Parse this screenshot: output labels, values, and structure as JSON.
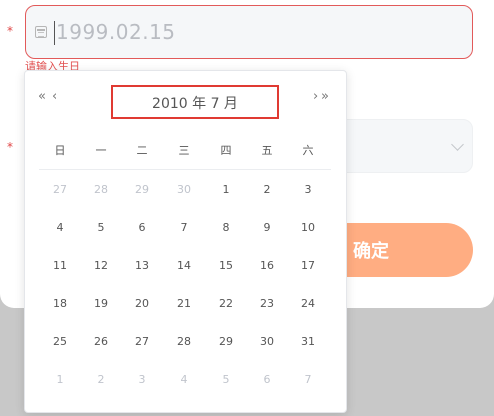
{
  "form": {
    "required_mark": "*",
    "date_value": "1999.02.15",
    "error_text": "请输入生日",
    "confirm_label": "确定"
  },
  "picker": {
    "nav_prev_year": "«",
    "nav_prev_month": "‹",
    "nav_next_month": "›",
    "nav_next_year": "»",
    "header": "2010 年  7 月",
    "weekdays": [
      "日",
      "一",
      "二",
      "三",
      "四",
      "五",
      "六"
    ],
    "weeks": [
      [
        {
          "d": "27",
          "o": true
        },
        {
          "d": "28",
          "o": true
        },
        {
          "d": "29",
          "o": true
        },
        {
          "d": "30",
          "o": true
        },
        {
          "d": "1",
          "o": false
        },
        {
          "d": "2",
          "o": false
        },
        {
          "d": "3",
          "o": false
        }
      ],
      [
        {
          "d": "4",
          "o": false
        },
        {
          "d": "5",
          "o": false
        },
        {
          "d": "6",
          "o": false
        },
        {
          "d": "7",
          "o": false
        },
        {
          "d": "8",
          "o": false
        },
        {
          "d": "9",
          "o": false
        },
        {
          "d": "10",
          "o": false
        }
      ],
      [
        {
          "d": "11",
          "o": false
        },
        {
          "d": "12",
          "o": false
        },
        {
          "d": "13",
          "o": false
        },
        {
          "d": "14",
          "o": false
        },
        {
          "d": "15",
          "o": false
        },
        {
          "d": "16",
          "o": false
        },
        {
          "d": "17",
          "o": false
        }
      ],
      [
        {
          "d": "18",
          "o": false
        },
        {
          "d": "19",
          "o": false
        },
        {
          "d": "20",
          "o": false
        },
        {
          "d": "21",
          "o": false
        },
        {
          "d": "22",
          "o": false
        },
        {
          "d": "23",
          "o": false
        },
        {
          "d": "24",
          "o": false
        }
      ],
      [
        {
          "d": "25",
          "o": false
        },
        {
          "d": "26",
          "o": false
        },
        {
          "d": "27",
          "o": false
        },
        {
          "d": "28",
          "o": false
        },
        {
          "d": "29",
          "o": false
        },
        {
          "d": "30",
          "o": false
        },
        {
          "d": "31",
          "o": false
        }
      ],
      [
        {
          "d": "1",
          "o": true
        },
        {
          "d": "2",
          "o": true
        },
        {
          "d": "3",
          "o": true
        },
        {
          "d": "4",
          "o": true
        },
        {
          "d": "5",
          "o": true
        },
        {
          "d": "6",
          "o": true
        },
        {
          "d": "7",
          "o": true
        }
      ]
    ]
  },
  "colors": {
    "error": "#e35151",
    "confirm_button": "#ffad82",
    "highlight_box": "#e03a32"
  }
}
